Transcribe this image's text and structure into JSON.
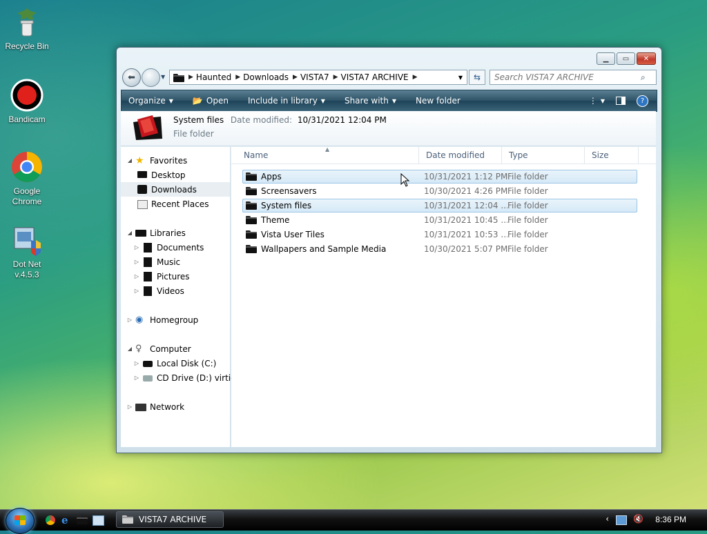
{
  "desktop": {
    "icons": [
      {
        "label": "Recycle Bin"
      },
      {
        "label": "Bandicam"
      },
      {
        "label": "Google Chrome"
      },
      {
        "label": "Dot Net v.4.5.3"
      }
    ]
  },
  "window": {
    "breadcrumbs": [
      "Haunted",
      "Downloads",
      "VISTA7",
      "VISTA7 ARCHIVE"
    ],
    "search_placeholder": "Search VISTA7 ARCHIVE",
    "toolbar": {
      "organize": "Organize",
      "open": "Open",
      "include_in_library": "Include in library",
      "share_with": "Share with",
      "new_folder": "New folder"
    },
    "details": {
      "name": "System files",
      "date_label": "Date modified:",
      "date_value": "10/31/2021 12:04 PM",
      "type": "File folder"
    },
    "nav": {
      "favorites": "Favorites",
      "desktop": "Desktop",
      "downloads": "Downloads",
      "recent_places": "Recent Places",
      "libraries": "Libraries",
      "documents": "Documents",
      "music": "Music",
      "pictures": "Pictures",
      "videos": "Videos",
      "homegroup": "Homegroup",
      "computer": "Computer",
      "local_disk": "Local Disk (C:)",
      "cd_drive": "CD Drive (D:) virtio-w",
      "network": "Network"
    },
    "columns": {
      "name": "Name",
      "date_modified": "Date modified",
      "type": "Type",
      "size": "Size"
    },
    "files": [
      {
        "name": "Apps",
        "date": "10/31/2021 1:12 PM",
        "type": "File folder"
      },
      {
        "name": "Screensavers",
        "date": "10/30/2021 4:26 PM",
        "type": "File folder"
      },
      {
        "name": "System files",
        "date": "10/31/2021 12:04 ...",
        "type": "File folder"
      },
      {
        "name": "Theme",
        "date": "10/31/2021 10:45 ...",
        "type": "File folder"
      },
      {
        "name": "Vista User Tiles",
        "date": "10/31/2021 10:53 ...",
        "type": "File folder"
      },
      {
        "name": "Wallpapers and Sample Media",
        "date": "10/30/2021 5:07 PM",
        "type": "File folder"
      }
    ]
  },
  "taskbar": {
    "task_label": "VISTA7 ARCHIVE",
    "clock": "8:36 PM"
  }
}
